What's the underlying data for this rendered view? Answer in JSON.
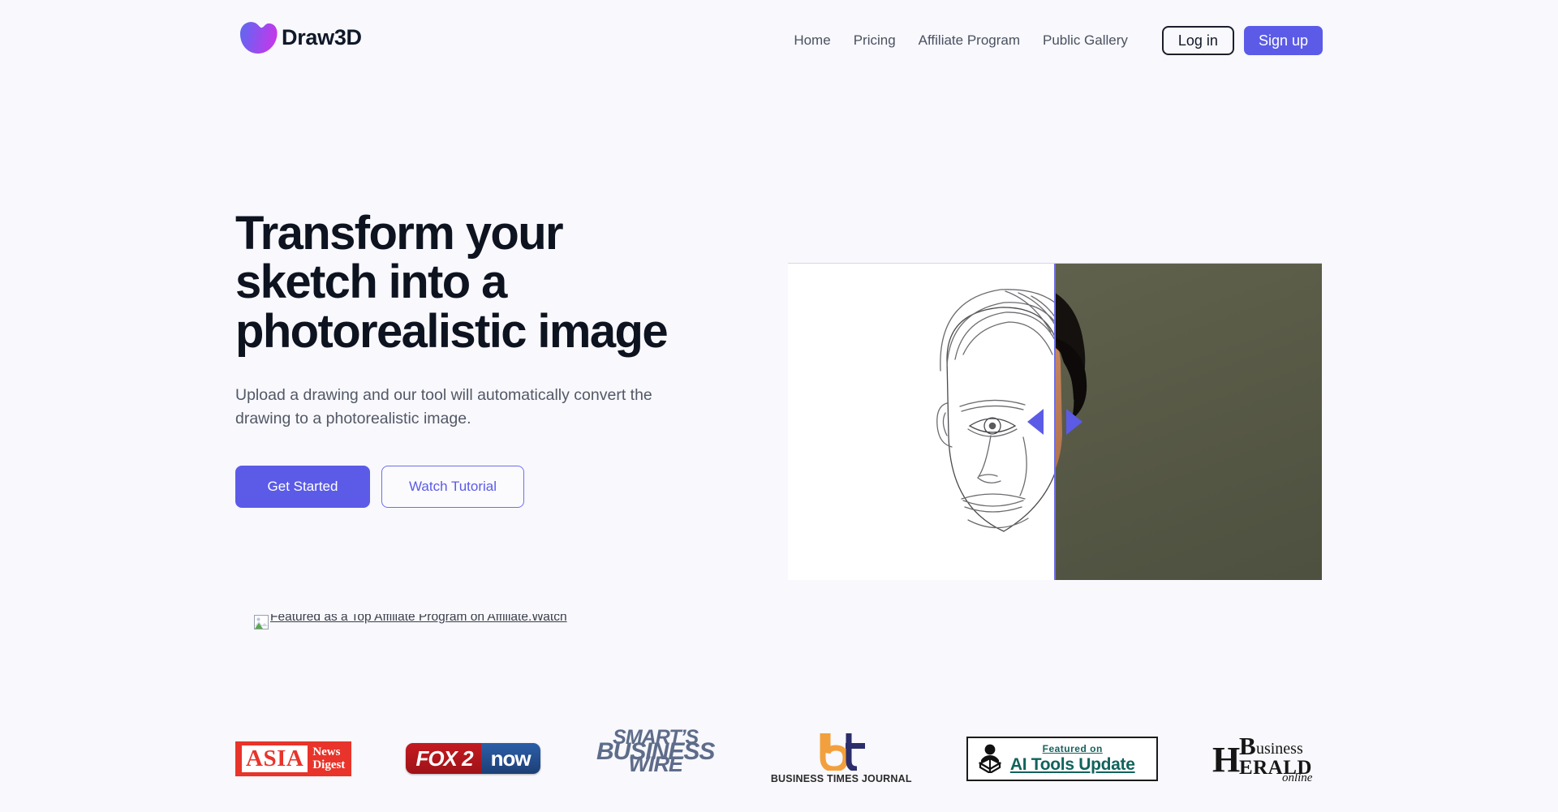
{
  "brand": {
    "name": "Draw3D",
    "logo_icon": "blob-logo-icon",
    "gradient_from": "#6366F1",
    "gradient_to": "#C936E8"
  },
  "theme": {
    "page_background": "#F8F8FD",
    "accent": "#5B5BE8",
    "heading_color": "#0E1320",
    "body_text_color": "#525866"
  },
  "header": {
    "nav_links": [
      {
        "label": "Home"
      },
      {
        "label": "Pricing"
      },
      {
        "label": "Affiliate Program"
      },
      {
        "label": "Public Gallery"
      }
    ],
    "login_label": "Log in",
    "signup_label": "Sign up"
  },
  "hero": {
    "title_line1": "Transform your",
    "title_line2": "sketch into a",
    "title_line3": "photorealistic image",
    "subtitle": "Upload a drawing and our tool will automatically convert the drawing to a photorealistic image.",
    "primary_button": "Get Started",
    "secondary_button": "Watch Tutorial",
    "comparison": {
      "before_label": "pencil-sketch-portrait",
      "after_label": "photorealistic-portrait",
      "slider_position_percent": 50,
      "divider_color": "#6F6FE8",
      "after_background_color": "#585A48"
    }
  },
  "affiliate_badge": {
    "alt_text": "Featured as a Top Affiliate Program on Affiliate.Watch",
    "icon": "broken-image-icon"
  },
  "press": {
    "logos": [
      {
        "name": "asia-news-digest",
        "word": "ASIA",
        "line1": "News",
        "line2": "Digest",
        "color": "#E8342A"
      },
      {
        "name": "fox-2-now",
        "part1": "FOX 2",
        "part2": "now"
      },
      {
        "name": "smarts-business-wire",
        "line1": "SMART’S",
        "line2": "BUSINESS",
        "line3": "WIRE",
        "color": "#5E6C8A"
      },
      {
        "name": "business-times-journal",
        "text": "BUSINESS TIMES JOURNAL",
        "mark_color_primary": "#F2A03D",
        "mark_color_secondary": "#2B2E6B"
      },
      {
        "name": "ai-tools-update",
        "featured_on": "Featured on",
        "title": "AI Tools Update",
        "color": "#11635C"
      },
      {
        "name": "business-herald-online",
        "h": "H",
        "b": "B",
        "business": "usiness",
        "erald": "ERALD",
        "online": "online"
      }
    ]
  }
}
